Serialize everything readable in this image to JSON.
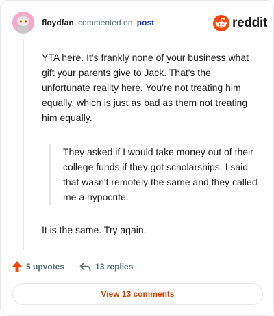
{
  "header": {
    "username": "floydfan",
    "action_text": "commented on",
    "post_link": "post",
    "avatar_icon": "snoo-avatar-icon",
    "brand": "reddit",
    "brand_icon": "reddit-logo-icon"
  },
  "comment": {
    "paragraph_1": "YTA here. It's frankly none of your business what gift your parents give to Jack. That's the unfortunate reality here. You're not treating him equally, which is just as bad as them not treating him equally.",
    "quote": "They asked if I would take money out of their college funds if they got scholarships. I said that wasn't remotely the same and they called me a hypocrite.",
    "paragraph_2": "It is the same. Try again."
  },
  "actions": {
    "upvotes": "5 upvotes",
    "replies": "13 replies",
    "view_button": "View 13 comments"
  },
  "colors": {
    "accent": "#ff4500",
    "link": "#1e40af",
    "view_button_text": "#d93a00",
    "muted": "#576f76",
    "avatar_bg": "#f7a8c8"
  }
}
